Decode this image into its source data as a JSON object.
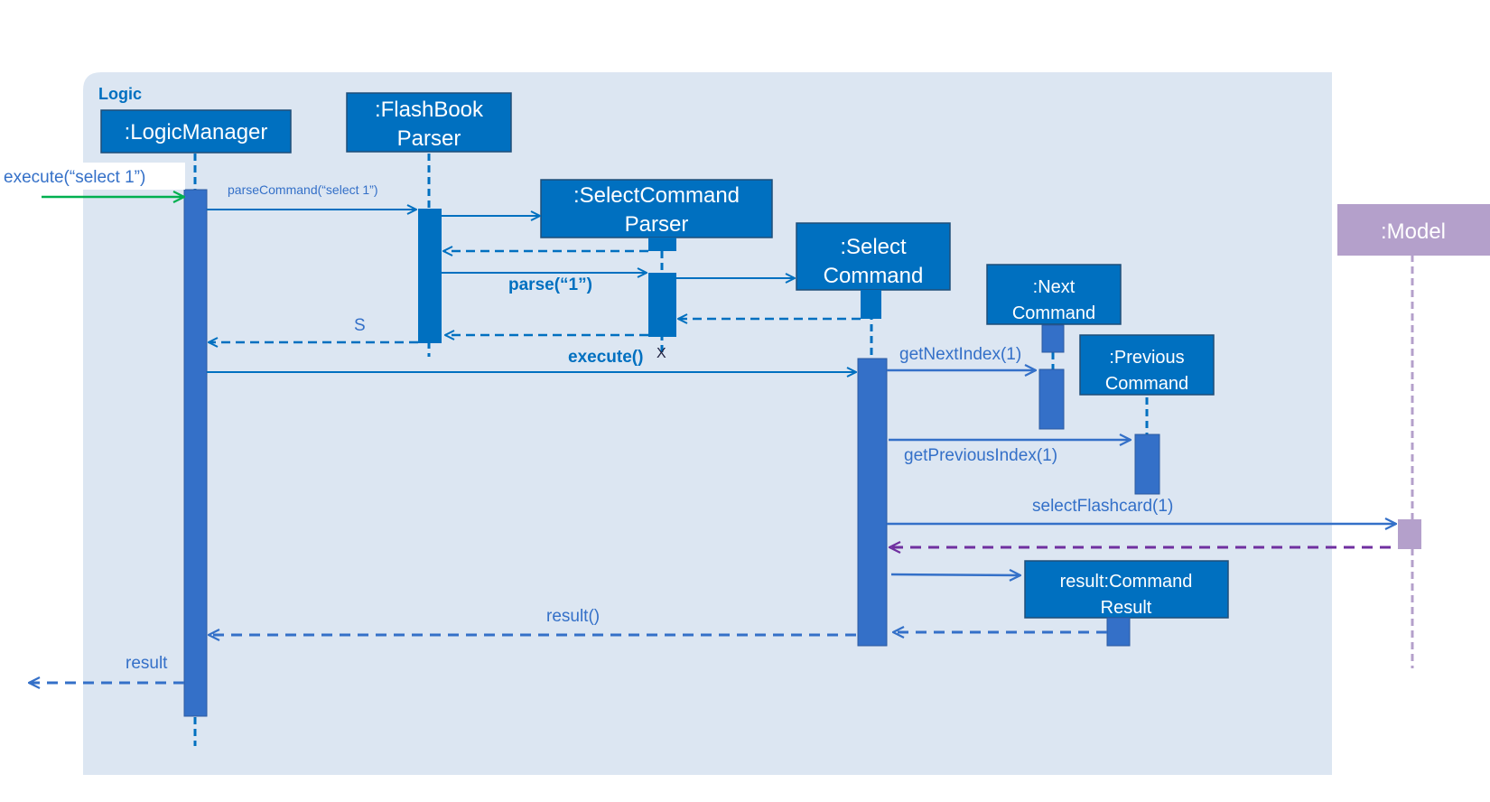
{
  "frame": {
    "label": "Logic"
  },
  "participants": {
    "logic_manager": {
      "label": ":LogicManager"
    },
    "flashbook_parser": {
      "line1": ":FlashBook",
      "line2": "Parser"
    },
    "select_command_parser": {
      "line1": ":SelectCommand",
      "line2": "Parser"
    },
    "select_command": {
      "line1": ":Select",
      "line2": "Command"
    },
    "next_command": {
      "line1": ":Next",
      "line2": "Command"
    },
    "previous_command": {
      "line1": ":Previous",
      "line2": "Command"
    },
    "command_result": {
      "line1": "result:Command",
      "line2": "Result"
    },
    "model": {
      "label": ":Model"
    }
  },
  "messages": {
    "execute_in": "execute(“select 1”)",
    "parse_command": "parseCommand(“select 1”)",
    "parse": "parse(“1”)",
    "return_s": "S",
    "execute": "execute()",
    "destroy_mark": "X",
    "get_next_index": "getNextIndex(1)",
    "get_previous_index": "getPreviousIndex(1)",
    "select_flashcard": "selectFlashcard(1)",
    "result_call": "result()",
    "result_out": "result"
  },
  "colors": {
    "frame": "#dce6f2",
    "object": "#0070c0",
    "activation": "#3470c8",
    "model": "#b4a0cb",
    "incoming_arrow": "#00b050",
    "model_return": "#7030a0"
  }
}
